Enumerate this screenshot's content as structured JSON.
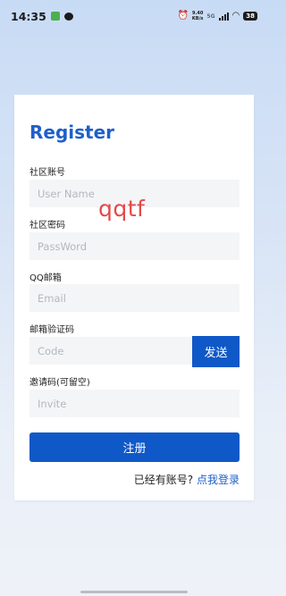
{
  "status_bar": {
    "time": "14:35",
    "net_speed_value": "9.40",
    "net_speed_unit": "KB/s",
    "network_type": "5G",
    "battery": "38"
  },
  "form": {
    "title": "Register",
    "username": {
      "label": "社区账号",
      "placeholder": "User Name"
    },
    "password": {
      "label": "社区密码",
      "placeholder": "PassWord"
    },
    "email": {
      "label": "QQ邮箱",
      "placeholder": "Email"
    },
    "code": {
      "label": "邮箱验证码",
      "placeholder": "Code",
      "send_label": "发送"
    },
    "invite": {
      "label": "邀请码(可留空)",
      "placeholder": "Invite"
    },
    "submit_label": "注册",
    "login_prompt": "已经有账号?",
    "login_link": "点我登录"
  },
  "watermark": "qqtf",
  "colors": {
    "accent": "#0f58c7",
    "title": "#1f5fc8",
    "watermark": "#e54848",
    "input_bg": "#f4f5f7"
  }
}
